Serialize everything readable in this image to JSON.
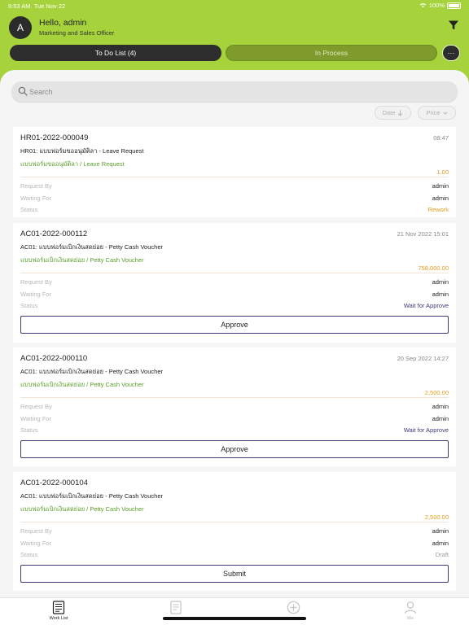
{
  "status_bar": {
    "time": "9:53 AM",
    "date": "Tue Nov 22",
    "battery": "100%"
  },
  "header": {
    "avatar_initial": "A",
    "greeting": "Hello, admin",
    "role": "Marketing and Sales Officer"
  },
  "tabs": {
    "todo_label": "To Do List (4)",
    "process_label": "In Process",
    "more_label": "···"
  },
  "search": {
    "placeholder": "Search",
    "value": ""
  },
  "sort": {
    "date_label": "Date",
    "price_label": "Price"
  },
  "labels": {
    "request_by": "Request By",
    "waiting_for": "Waiting For",
    "status": "Status"
  },
  "cards": [
    {
      "code": "HR01-2022-000049",
      "time": "08:47",
      "title": "HR01: แบบฟอร์มขออนุมัติลา - Leave Request",
      "subtitle": "แบบฟอร์มขออนุมัติลา / Leave Request",
      "amount": "1.00",
      "request_by": "admin",
      "waiting_for": "admin",
      "status": "Rework"
    },
    {
      "code": "AC01-2022-000112",
      "time": "21 Nov 2022 15:01",
      "title": "AC01: แบบฟอร์มเบิกเงินสดย่อย - Petty Cash Voucher",
      "subtitle": "แบบฟอร์มเบิกเงินสดย่อย / Petty Cash Voucher",
      "amount": "758,000.00",
      "request_by": "admin",
      "waiting_for": "admin",
      "status": "Wait for Approve",
      "action": "Approve"
    },
    {
      "code": "AC01-2022-000110",
      "time": "20 Sep 2022 14:27",
      "title": "AC01: แบบฟอร์มเบิกเงินสดย่อย - Petty Cash Voucher",
      "subtitle": "แบบฟอร์มเบิกเงินสดย่อย / Petty Cash Voucher",
      "amount": "2,500.00",
      "request_by": "admin",
      "waiting_for": "admin",
      "status": "Wait for Approve",
      "action": "Approve"
    },
    {
      "code": "AC01-2022-000104",
      "time": "",
      "title": "AC01: แบบฟอร์มเบิกเงินสดย่อย - Petty Cash Voucher",
      "subtitle": "แบบฟอร์มเบิกเงินสดย่อย / Petty Cash Voucher",
      "amount": "2,500.00",
      "request_by": "admin",
      "waiting_for": "admin",
      "status": "Draft",
      "action": "Submit"
    }
  ],
  "bottom_nav": [
    {
      "label": "Work List",
      "icon": "worklist-icon",
      "active": true
    },
    {
      "label": "",
      "icon": "document-icon",
      "active": false
    },
    {
      "label": "",
      "icon": "add-circle-icon",
      "active": false
    },
    {
      "label": "Me",
      "icon": "user-icon",
      "active": false
    }
  ],
  "colors": {
    "brand_green": "#a6d33c",
    "dark": "#2d2d2d",
    "orange": "#e59a1c",
    "navy": "#3a3a7a",
    "green_text": "#5a9e2a"
  }
}
